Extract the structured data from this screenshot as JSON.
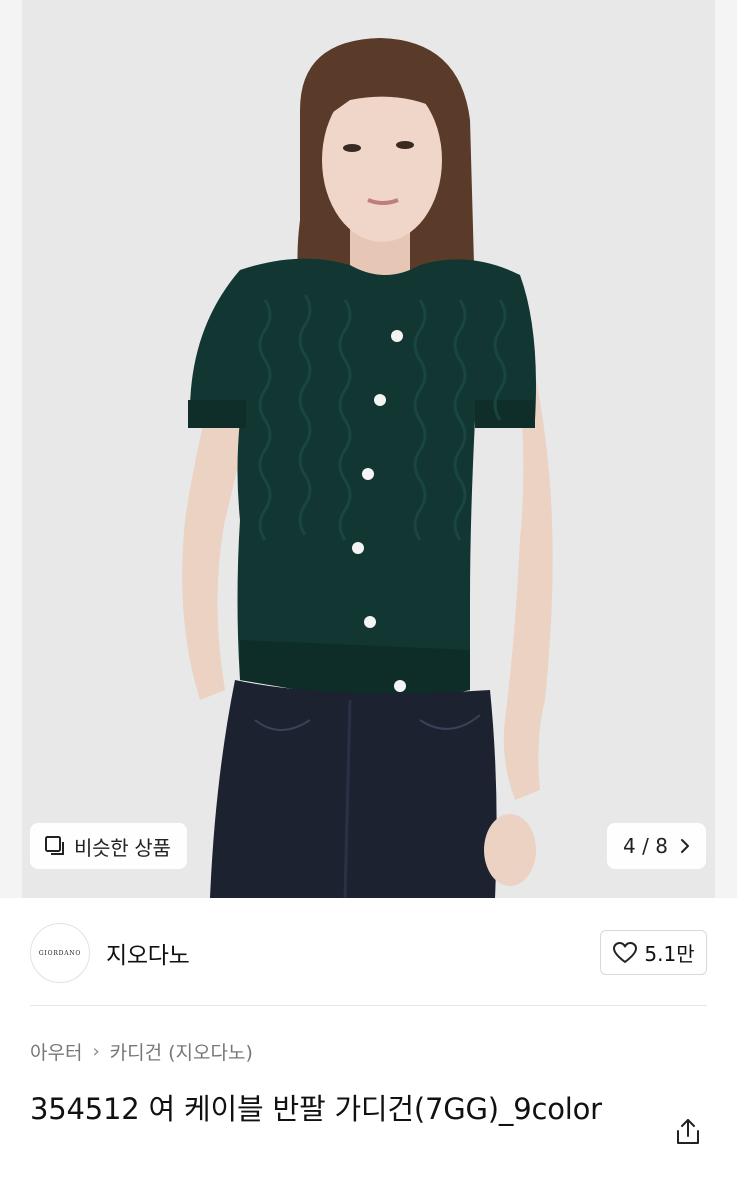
{
  "hero": {
    "similar_label": "비슷한 상품",
    "pager_text": "4 / 8"
  },
  "brand": {
    "logo_text": "GIORDANO",
    "name": "지오다노",
    "like_count": "5.1만"
  },
  "breadcrumb": {
    "category": "아우터",
    "subcategory": "카디건 (지오다노)"
  },
  "product": {
    "title": "354512 여 케이블 반팔 가디건(7GG)_9color"
  },
  "colors": {
    "background": "#e9e9ea",
    "cardigan": "#123632",
    "jeans": "#1c2230",
    "hair": "#5a3b2a",
    "skin": "#ecd2c3"
  },
  "icons": [
    "square-stack-icon",
    "chevron-right-icon",
    "heart-icon",
    "share-icon"
  ]
}
